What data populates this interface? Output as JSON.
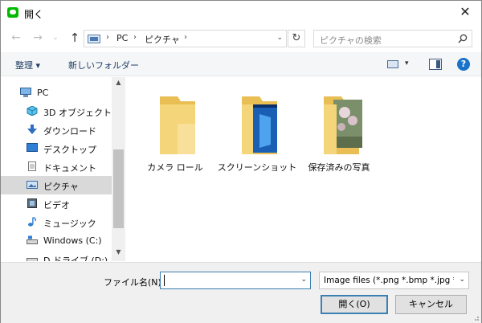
{
  "window": {
    "title": "開く",
    "close_glyph": "✕"
  },
  "nav": {
    "back_glyph": "←",
    "forward_glyph": "→",
    "recent_glyph": "⌄",
    "up_glyph": "↑",
    "breadcrumbs": [
      "PC",
      "ピクチャ"
    ],
    "breadcrumb_sep": "›",
    "address_drop_glyph": "⌄",
    "refresh_glyph": "↻",
    "search_placeholder": "ピクチャの検索"
  },
  "toolbar": {
    "organize_label": "整理 ▾",
    "new_folder_label": "新しいフォルダー",
    "view_drop_glyph": "▾",
    "help_glyph": "?"
  },
  "sidebar": {
    "items": [
      {
        "label": "PC",
        "icon": "pc-icon",
        "selected": false
      },
      {
        "label": "3D オブジェクト",
        "icon": "3d-objects-icon",
        "selected": false
      },
      {
        "label": "ダウンロード",
        "icon": "download-icon",
        "selected": false
      },
      {
        "label": "デスクトップ",
        "icon": "desktop-icon",
        "selected": false
      },
      {
        "label": "ドキュメント",
        "icon": "documents-icon",
        "selected": false
      },
      {
        "label": "ピクチャ",
        "icon": "pictures-icon",
        "selected": true
      },
      {
        "label": "ビデオ",
        "icon": "videos-icon",
        "selected": false
      },
      {
        "label": "ミュージック",
        "icon": "music-icon",
        "selected": false
      },
      {
        "label": "Windows (C:)",
        "icon": "drive-icon",
        "selected": false
      },
      {
        "label": "D ドライブ (D:)",
        "icon": "drive-icon",
        "selected": false
      }
    ],
    "scroll_up_glyph": "▲",
    "scroll_down_glyph": "▼"
  },
  "folders": [
    {
      "label": "カメラ ロール",
      "icon": "folder-icon"
    },
    {
      "label": "スクリーンショット",
      "icon": "folder-screenshot-icon"
    },
    {
      "label": "保存済みの写真",
      "icon": "folder-photo-icon"
    }
  ],
  "bottom": {
    "filename_label": "ファイル名(N):",
    "filename_value": "",
    "filename_drop_glyph": "⌄",
    "filetype_value": "Image files (*.png *.bmp *.jpg *.",
    "filetype_drop_glyph": "⌄",
    "open_label": "開く(O)",
    "cancel_label": "キャンセル"
  },
  "colors": {
    "accent": "#3c7fb1",
    "selection": "#d9d9d9",
    "folder": "#f5d57a",
    "help": "#1a73c8"
  }
}
